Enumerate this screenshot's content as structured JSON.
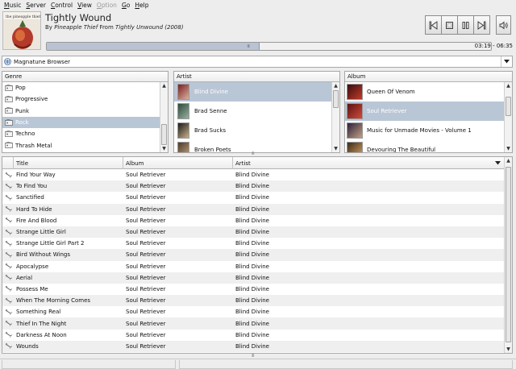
{
  "menu": [
    {
      "label": "Music",
      "mnemonic": "M",
      "rest": "usic",
      "enabled": true
    },
    {
      "label": "Server",
      "mnemonic": "S",
      "rest": "erver",
      "enabled": true
    },
    {
      "label": "Control",
      "mnemonic": "C",
      "rest": "ontrol",
      "enabled": true
    },
    {
      "label": "View",
      "mnemonic": "V",
      "rest": "iew",
      "enabled": true
    },
    {
      "label": "Option",
      "mnemonic": "O",
      "rest": "ption",
      "enabled": false
    },
    {
      "label": "Go",
      "mnemonic": "G",
      "rest": "o",
      "enabled": true
    },
    {
      "label": "Help",
      "mnemonic": "H",
      "rest": "elp",
      "enabled": true
    }
  ],
  "now_playing": {
    "cover_text": "the pineapple thief",
    "title": "Tightly Wound",
    "by_label": "By",
    "artist": "Pineapple Thief",
    "from_label": "From",
    "album": "Tightly Unwound (2008)",
    "elapsed": "03:19",
    "total": "06:35",
    "time_display": "03:19 - 06:35",
    "progress_fraction": 0.48
  },
  "controls": {
    "prev_icon": "skip-previous-icon",
    "stop_icon": "stop-icon",
    "pause_icon": "pause-icon",
    "next_icon": "skip-next-icon",
    "volume_icon": "volume-icon"
  },
  "source": {
    "label": "Magnatune Browser",
    "icon": "magnatune-icon"
  },
  "genre_pane": {
    "header": "Genre",
    "items": [
      "Pop",
      "Progressive",
      "Punk",
      "Rock",
      "Techno",
      "Thrash Metal"
    ],
    "selected": "Rock"
  },
  "artist_pane": {
    "header": "Artist",
    "items": [
      "Blind Divine",
      "Brad Senne",
      "Brad Sucks",
      "Broken Poets"
    ],
    "selected": "Blind Divine"
  },
  "album_pane": {
    "header": "Album",
    "items": [
      "Queen Of Venom",
      "Soul Retriever",
      "Music for Unmade Movies - Volume 1",
      "Devouring The Beautiful"
    ],
    "selected": "Soul Retriever"
  },
  "playlist": {
    "columns": [
      "Title",
      "Album",
      "Artist"
    ],
    "rows": [
      {
        "title": "Find Your Way",
        "album": "Soul Retriever",
        "artist": "Blind Divine"
      },
      {
        "title": "To Find You",
        "album": "Soul Retriever",
        "artist": "Blind Divine"
      },
      {
        "title": "Sanctified",
        "album": "Soul Retriever",
        "artist": "Blind Divine"
      },
      {
        "title": "Hard To Hide",
        "album": "Soul Retriever",
        "artist": "Blind Divine"
      },
      {
        "title": "Fire And Blood",
        "album": "Soul Retriever",
        "artist": "Blind Divine"
      },
      {
        "title": "Strange Little Girl",
        "album": "Soul Retriever",
        "artist": "Blind Divine"
      },
      {
        "title": "Strange Little Girl Part 2",
        "album": "Soul Retriever",
        "artist": "Blind Divine"
      },
      {
        "title": "Bird Without Wings",
        "album": "Soul Retriever",
        "artist": "Blind Divine"
      },
      {
        "title": "Apocalypse",
        "album": "Soul Retriever",
        "artist": "Blind Divine"
      },
      {
        "title": "Aerial",
        "album": "Soul Retriever",
        "artist": "Blind Divine"
      },
      {
        "title": "Possess Me",
        "album": "Soul Retriever",
        "artist": "Blind Divine"
      },
      {
        "title": "When The Morning Comes",
        "album": "Soul Retriever",
        "artist": "Blind Divine"
      },
      {
        "title": "Something Real",
        "album": "Soul Retriever",
        "artist": "Blind Divine"
      },
      {
        "title": "Thief In The Night",
        "album": "Soul Retriever",
        "artist": "Blind Divine"
      },
      {
        "title": "Darkness At Noon",
        "album": "Soul Retriever",
        "artist": "Blind Divine"
      },
      {
        "title": "Wounds",
        "album": "Soul Retriever",
        "artist": "Blind Divine"
      }
    ]
  },
  "colors": {
    "selection": "#b9c6d6",
    "progress_fill": "#b8c4d4"
  }
}
